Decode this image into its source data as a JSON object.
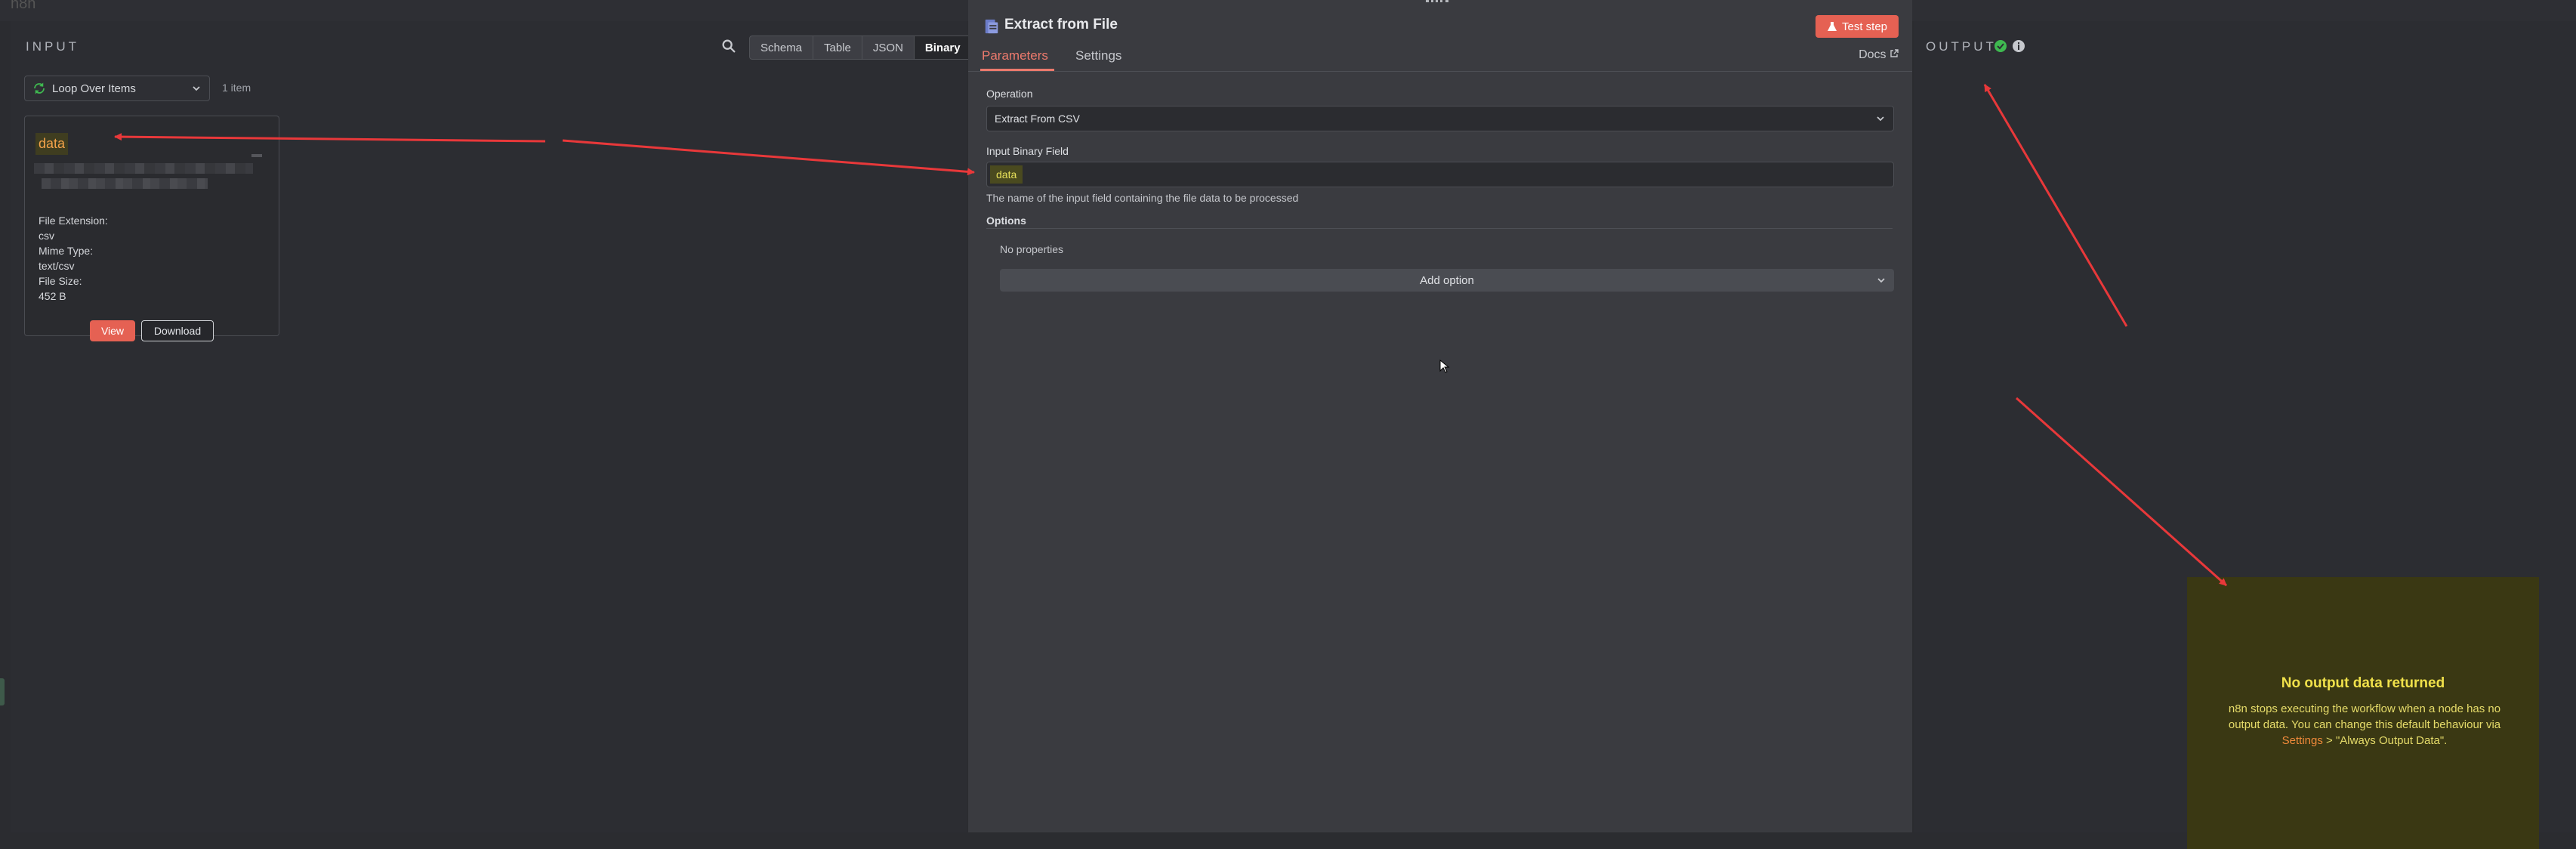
{
  "topbar": {
    "logo": "n8n"
  },
  "input": {
    "label": "INPUT",
    "tabs": [
      "Schema",
      "Table",
      "JSON",
      "Binary"
    ],
    "source": "Loop Over Items",
    "item_count": "1 item",
    "binary": {
      "name": "data",
      "file_extension_label": "File Extension:",
      "file_extension": "csv",
      "mime_type_label": "Mime Type:",
      "mime_type": "text/csv",
      "file_size_label": "File Size:",
      "file_size": "452 B",
      "view_label": "View",
      "download_label": "Download"
    }
  },
  "node": {
    "title": "Extract from File",
    "test_label": "Test step",
    "tabs": {
      "parameters": "Parameters",
      "settings": "Settings"
    },
    "docs_label": "Docs",
    "operation_label": "Operation",
    "operation_value": "Extract From CSV",
    "binary_field_label": "Input Binary Field",
    "binary_field_value": "data",
    "binary_field_hint": "The name of the input field containing the file data to be processed",
    "options_label": "Options",
    "no_properties": "No properties",
    "add_option_label": "Add option"
  },
  "output": {
    "label": "OUTPUT",
    "no_output_title": "No output data returned",
    "no_output_msg_1": "n8n stops executing the workflow when a node has no output data. You can change this default behaviour via ",
    "no_output_link": "Settings",
    "no_output_msg_2": " > \"Always Output Data\"."
  },
  "colors": {
    "accent": "#e56153",
    "annotation_arrow": "#e8383a",
    "success": "#3fb950",
    "warning_bg": "#3a3813",
    "warning_text": "#f0e14a"
  },
  "icons": [
    "search-icon",
    "loop-icon",
    "chevron-down-icon",
    "file-extract-icon",
    "flask-icon",
    "external-link-icon",
    "check-circle-icon",
    "info-icon",
    "cursor-icon"
  ]
}
